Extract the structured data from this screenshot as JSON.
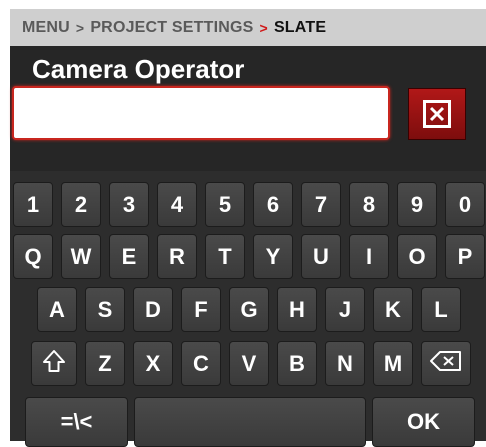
{
  "breadcrumb": {
    "items": [
      "MENU",
      "PROJECT SETTINGS",
      "SLATE"
    ],
    "separator": ">"
  },
  "field": {
    "label": "Camera Operator",
    "value": "",
    "placeholder": ""
  },
  "clear_button": {
    "icon": "close-icon"
  },
  "keyboard": {
    "row1": [
      "1",
      "2",
      "3",
      "4",
      "5",
      "6",
      "7",
      "8",
      "9",
      "0"
    ],
    "row2": [
      "Q",
      "W",
      "E",
      "R",
      "T",
      "Y",
      "U",
      "I",
      "O",
      "P"
    ],
    "row3": [
      "A",
      "S",
      "D",
      "F",
      "G",
      "H",
      "J",
      "K",
      "L"
    ],
    "row4": [
      "Z",
      "X",
      "C",
      "V",
      "B",
      "N",
      "M"
    ],
    "shift_icon": "shift-icon",
    "backspace_icon": "backspace-icon",
    "symbols_label": "=\\<",
    "space_label": "",
    "ok_label": "OK"
  },
  "colors": {
    "accent": "#c8261f",
    "key_bg": "#434343",
    "screen_bg": "#2d2d2d",
    "header_bg": "#cfcfcf"
  }
}
